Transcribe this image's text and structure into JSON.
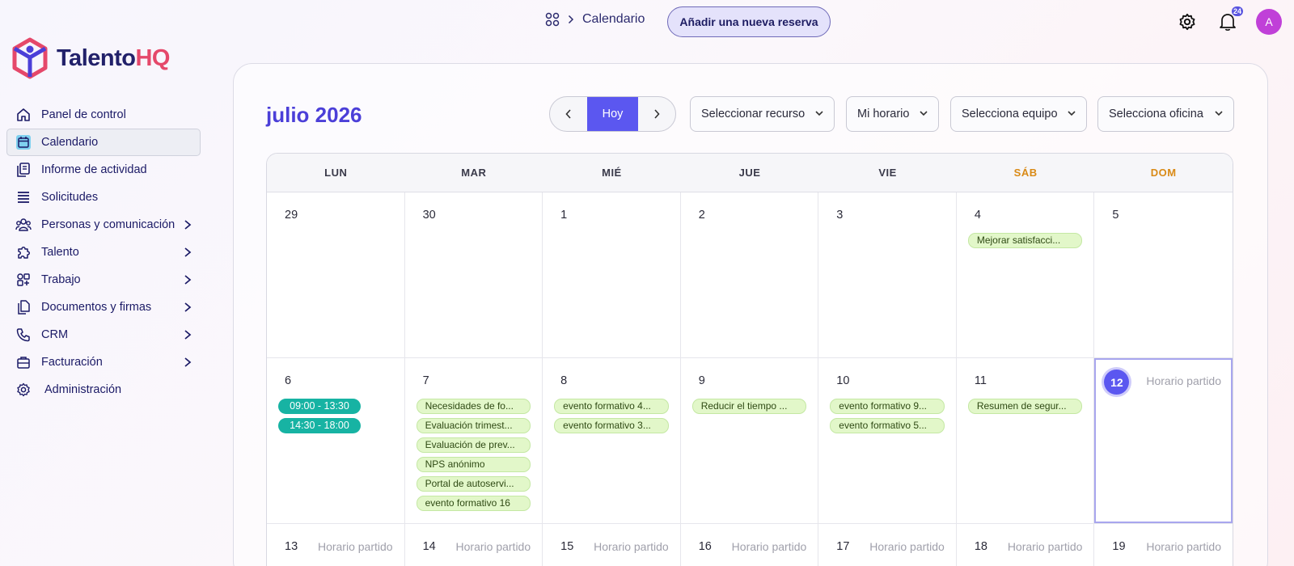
{
  "app": {
    "logo_main": "Talento",
    "logo_accent": "HQ"
  },
  "header": {
    "breadcrumb": "Calendario",
    "add_button": "Añadir una nueva reserva",
    "notifications_count": "24",
    "avatar_initial": "A"
  },
  "sidebar": {
    "items": [
      {
        "label": "Panel de control",
        "icon": "home-icon"
      },
      {
        "label": "Calendario",
        "icon": "calendar-icon"
      },
      {
        "label": "Informe de actividad",
        "icon": "report-icon"
      },
      {
        "label": "Solicitudes",
        "icon": "list-icon"
      },
      {
        "label": "Personas y comunicación",
        "icon": "people-icon"
      },
      {
        "label": "Talento",
        "icon": "puzzle-icon"
      },
      {
        "label": "Trabajo",
        "icon": "grid-icon"
      },
      {
        "label": "Documentos y firmas",
        "icon": "documents-icon"
      },
      {
        "label": "CRM",
        "icon": "phone-icon"
      },
      {
        "label": "Facturación",
        "icon": "briefcase-icon"
      },
      {
        "label": "Administración",
        "icon": "gear-icon"
      }
    ]
  },
  "calendar": {
    "month_title": "julio 2026",
    "today_button": "Hoy",
    "filters": {
      "resource": "Seleccionar recurso",
      "schedule": "Mi horario",
      "team": "Selecciona equipo",
      "office": "Selecciona oficina"
    },
    "weekdays": [
      "LUN",
      "MAR",
      "MIÉ",
      "JUE",
      "VIE",
      "SÁB",
      "DOM"
    ],
    "schedule_label": "Horario partido",
    "weeks": [
      {
        "days": [
          {
            "num": "29",
            "events": []
          },
          {
            "num": "30",
            "events": []
          },
          {
            "num": "1",
            "events": []
          },
          {
            "num": "2",
            "events": []
          },
          {
            "num": "3",
            "events": []
          },
          {
            "num": "4",
            "events": [
              "Mejorar satisfacci..."
            ]
          },
          {
            "num": "5",
            "events": []
          }
        ]
      },
      {
        "days": [
          {
            "num": "6",
            "shifts": [
              "09:00 - 13:30",
              "14:30 - 18:00"
            ],
            "events": []
          },
          {
            "num": "7",
            "events": [
              "Necesidades de fo...",
              "Evaluación trimest...",
              "Evaluación de prev...",
              "NPS anónimo",
              "Portal de autoservi...",
              "evento formativo 16"
            ]
          },
          {
            "num": "8",
            "events": [
              "evento formativo 4...",
              "evento formativo 3..."
            ]
          },
          {
            "num": "9",
            "events": [
              "Reducir el tiempo ..."
            ]
          },
          {
            "num": "10",
            "events": [
              "evento formativo 9...",
              "evento formativo 5..."
            ]
          },
          {
            "num": "11",
            "events": [
              "Resumen de segur..."
            ]
          },
          {
            "num": "12",
            "today": true,
            "schedule": "Horario partido",
            "events": []
          }
        ]
      },
      {
        "days": [
          {
            "num": "13",
            "schedule": "Horario partido"
          },
          {
            "num": "14",
            "schedule": "Horario partido"
          },
          {
            "num": "15",
            "schedule": "Horario partido"
          },
          {
            "num": "16",
            "schedule": "Horario partido"
          },
          {
            "num": "17",
            "schedule": "Horario partido"
          },
          {
            "num": "18",
            "schedule": "Horario partido"
          },
          {
            "num": "19",
            "schedule": "Horario partido"
          }
        ]
      }
    ]
  },
  "colors": {
    "accent": "#5b57f0",
    "weekend": "#d98a16",
    "event_bg": "#e2f7c9",
    "shift_bg": "#17b3a3",
    "logo_accent": "#e5486a"
  }
}
